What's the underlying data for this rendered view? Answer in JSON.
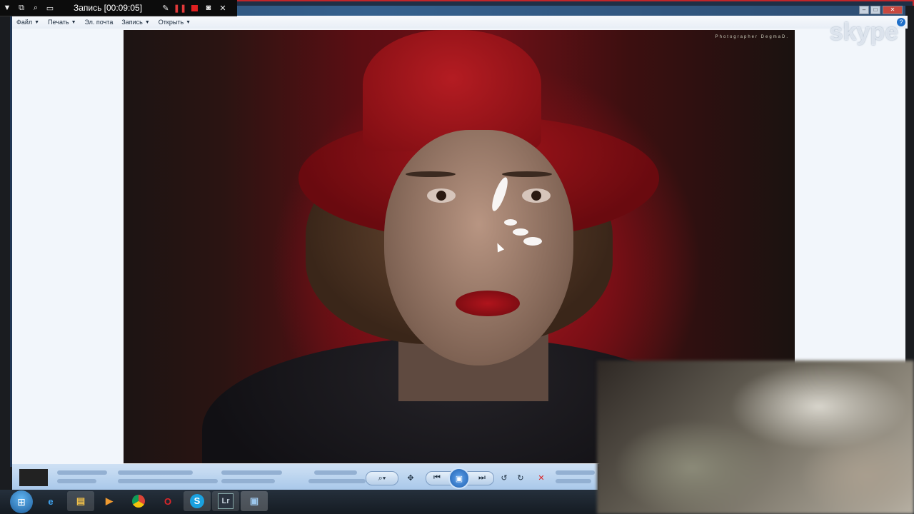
{
  "recorder": {
    "title": "Запись [00:09:05]",
    "icons": [
      "menu-triangle-icon",
      "restore-icon",
      "zoom-icon",
      "region-icon",
      "pen-icon",
      "pause-icon",
      "stop-icon",
      "camera-icon",
      "close-icon"
    ]
  },
  "menubar": {
    "items": [
      {
        "label": "Файл",
        "has_dropdown": true
      },
      {
        "label": "Печать",
        "has_dropdown": true
      },
      {
        "label": "Эл. почта",
        "has_dropdown": false
      },
      {
        "label": "Запись",
        "has_dropdown": true
      },
      {
        "label": "Открыть",
        "has_dropdown": true
      }
    ],
    "help_label": "?"
  },
  "photo": {
    "watermark": "Photographer DegmaD."
  },
  "skype": {
    "logo_text": "skype"
  },
  "viewer_controls": {
    "zoom_icon": "magnifier-icon",
    "fit_icon": "fit-window-icon",
    "prev_icon": "previous-icon",
    "slideshow_icon": "slideshow-icon",
    "next_icon": "next-icon",
    "rotate_ccw_icon": "rotate-left-icon",
    "rotate_cw_icon": "rotate-right-icon",
    "delete_icon": "delete-icon"
  },
  "taskbar": {
    "items": [
      "ie-icon",
      "explorer-icon",
      "media-player-icon",
      "chrome-icon",
      "opera-icon",
      "skype-icon",
      "lightroom-icon",
      "photo-viewer-icon"
    ],
    "lightroom_label": "Lr",
    "opera_label": "O",
    "skype_label": "S"
  },
  "colors": {
    "recording_red": "#c0262a",
    "window_blue": "#1f3553",
    "taskbar": "#1c242d"
  }
}
